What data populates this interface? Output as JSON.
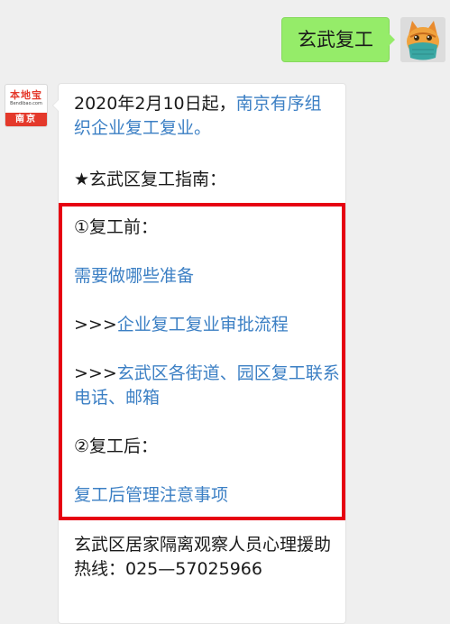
{
  "sent_message": {
    "text": "玄武复工"
  },
  "brand_avatar": {
    "name": "本地宝",
    "url": "Bendibao.com",
    "city": "南京"
  },
  "announcement": {
    "lead": "2020年2月10日起，",
    "link": "南京有序组织企业复工复业。"
  },
  "guide": {
    "heading": "★玄武区复工指南：",
    "before_title": "①复工前：",
    "before_link": "需要做哪些准备",
    "arrows": ">>>",
    "approval_link": "企业复工复业审批流程",
    "contacts_link": "玄武区各街道、园区复工联系电话、邮箱",
    "after_title": "②复工后：",
    "after_link": "复工后管理注意事项"
  },
  "hotline": {
    "text": "玄武区居家隔离观察人员心理援助热线：025—57025966"
  },
  "colors": {
    "highlight_border": "#e60012",
    "link": "#3b7fc4",
    "sent_bubble": "#95ec69"
  }
}
